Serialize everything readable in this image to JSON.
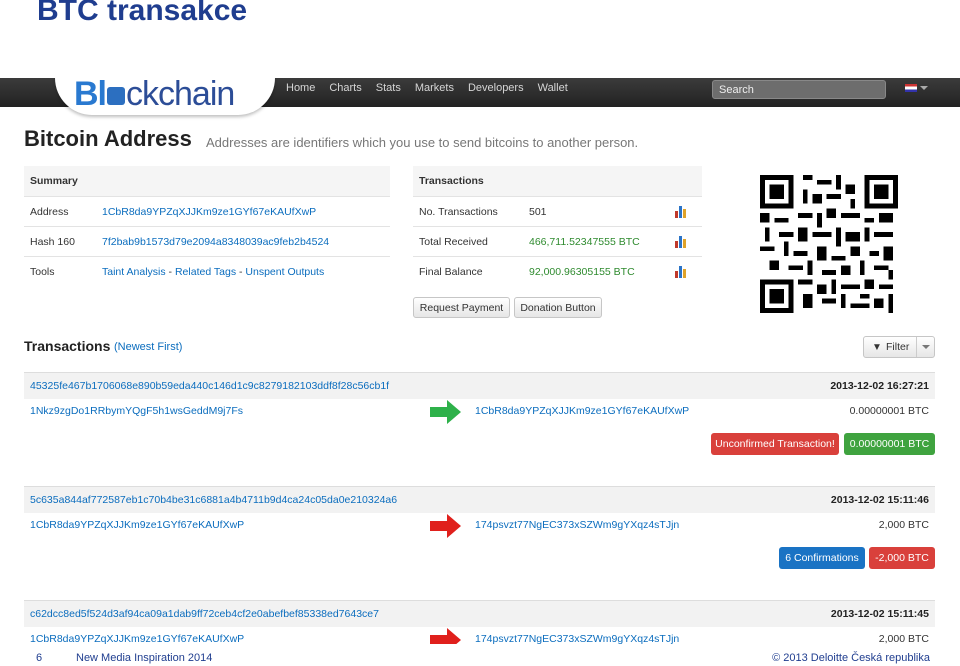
{
  "slide": {
    "title": "BTC transakce",
    "page_number": "6",
    "footer_center": "New Media Inspiration 2014",
    "footer_right": "© 2013 Deloitte Česká republika"
  },
  "navbar": {
    "logo_text_1": "Bl",
    "logo_text_2": "ckchain",
    "links": [
      "Home",
      "Charts",
      "Stats",
      "Markets",
      "Developers",
      "Wallet"
    ],
    "search_placeholder": "Search"
  },
  "page": {
    "title": "Bitcoin Address",
    "subtitle": "Addresses are identifiers which you use to send bitcoins to another person."
  },
  "summary": {
    "header": "Summary",
    "rows": [
      {
        "label": "Address",
        "value": "1CbR8da9YPZqXJJKm9ze1GYf67eKAUfXwP"
      },
      {
        "label": "Hash 160",
        "value": "7f2bab9b1573d79e2094a8348039ac9feb2b4524"
      },
      {
        "label": "Tools",
        "v1": "Taint Analysis",
        "sep1": " - ",
        "v2": "Related Tags",
        "sep2": " - ",
        "v3": "Unspent Outputs"
      }
    ]
  },
  "transactions_box": {
    "header": "Transactions",
    "rows": [
      {
        "label": "No. Transactions",
        "value": "501"
      },
      {
        "label": "Total Received",
        "value": "466,711.52347555 BTC"
      },
      {
        "label": "Final Balance",
        "value": "92,000.96305155 BTC"
      }
    ],
    "buttons": {
      "request": "Request Payment",
      "donation": "Donation Button"
    }
  },
  "tx_list": {
    "title": "Transactions",
    "subtitle": "(Newest First)",
    "filter_label": "Filter",
    "items": [
      {
        "hash": "45325fe467b1706068e890b59eda440c146d1c9c8279182103ddf8f28c56cb1f",
        "date": "2013-12-02 16:27:21",
        "from": "1Nkz9zgDo1RRbymYQgF5h1wsGeddM9j7Fs",
        "to": "1CbR8da9YPZqXJJKm9ze1GYf67eKAUfXwP",
        "amount": "0.00000001 BTC",
        "status": "Unconfirmed Transaction!",
        "value": "0.00000001 BTC",
        "direction": "in"
      },
      {
        "hash": "5c635a844af772587eb1c70b4be31c6881a4b4711b9d4ca24c05da0e210324a6",
        "date": "2013-12-02 15:11:46",
        "from": "1CbR8da9YPZqXJJKm9ze1GYf67eKAUfXwP",
        "to": "174psvzt77NgEC373xSZWm9gYXqz4sTJjn",
        "amount": "2,000 BTC",
        "status": "6 Confirmations",
        "value": "-2,000 BTC",
        "direction": "out"
      },
      {
        "hash": "c62dcc8ed5f524d3af94ca09a1dab9ff72ceb4cf2e0abefbef85338ed7643ce7",
        "date": "2013-12-02 15:11:45",
        "from": "1CbR8da9YPZqXJJKm9ze1GYf67eKAUfXwP",
        "to": "174psvzt77NgEC373xSZWm9gYXqz4sTJjn",
        "amount": "2,000 BTC",
        "direction": "out"
      }
    ]
  },
  "colors": {
    "slide_title": "#1f3d8f",
    "link": "#0b6dbe",
    "green": "#2f8b2f",
    "danger": "#d9403b",
    "success": "#3fa33f",
    "primary": "#1a73c4",
    "arrow_in": "#2eb14a",
    "arrow_out": "#e0201c"
  }
}
